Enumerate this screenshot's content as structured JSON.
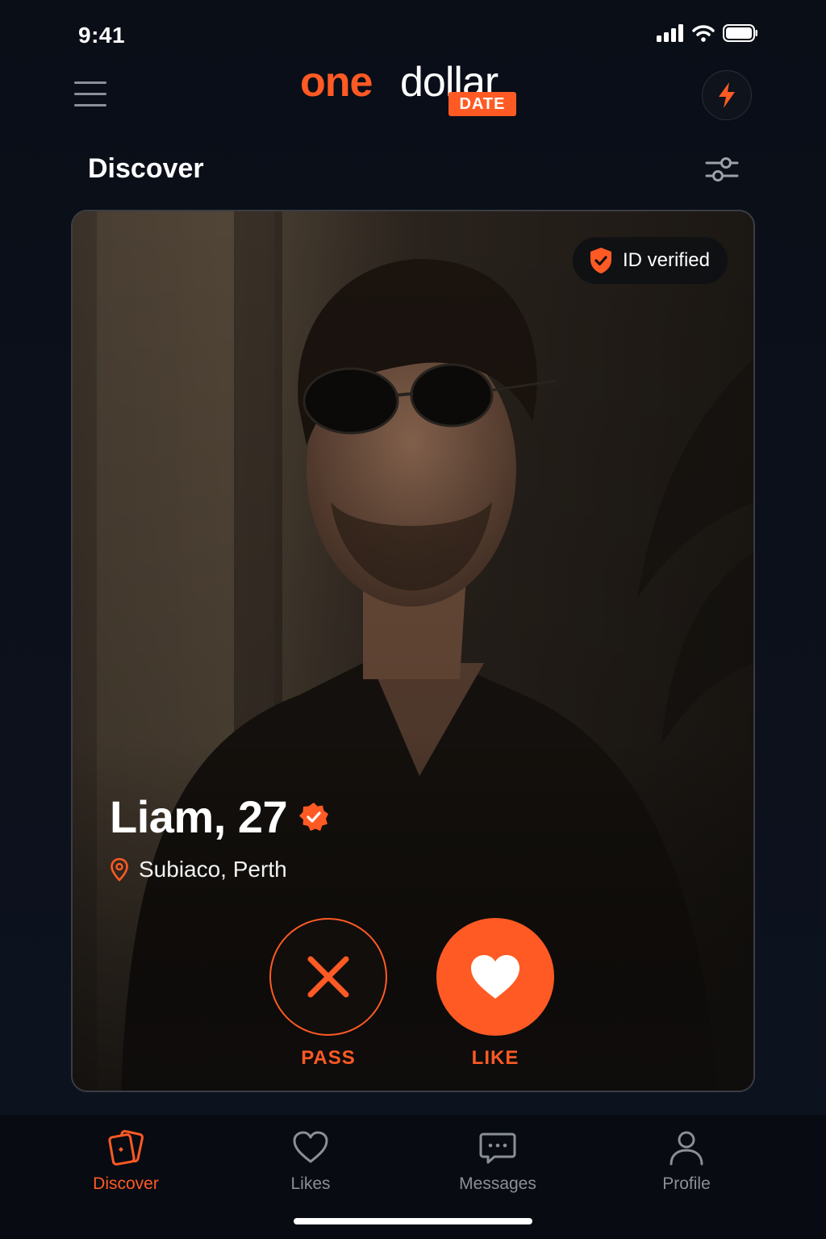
{
  "status_bar": {
    "time": "9:41"
  },
  "brand": {
    "logo_one": "one",
    "logo_dollar": "dollar",
    "logo_date": "DATE"
  },
  "header": {
    "title": "Discover"
  },
  "profile": {
    "name": "Liam, 27",
    "location": "Subiaco, Perth",
    "verified_label": "ID verified"
  },
  "actions": {
    "pass_label": "PASS",
    "like_label": "LIKE"
  },
  "tabs": [
    {
      "label": "Discover",
      "icon": "cards-icon",
      "active": true
    },
    {
      "label": "Likes",
      "icon": "heart-outline-icon",
      "active": false
    },
    {
      "label": "Messages",
      "icon": "chat-bubble-icon",
      "active": false
    },
    {
      "label": "Profile",
      "icon": "person-icon",
      "active": false
    }
  ],
  "colors": {
    "accent": "#ff5a24",
    "background": "#0b0f18",
    "muted": "#8a8f98"
  }
}
